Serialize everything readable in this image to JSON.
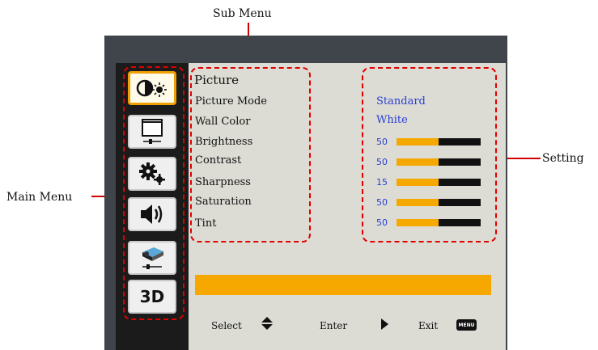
{
  "callouts": {
    "sub_menu": "Sub Menu",
    "setting": "Setting",
    "main_menu": "Main Menu"
  },
  "main_menu": {
    "items": [
      {
        "icon": "picture-icon",
        "active": true
      },
      {
        "icon": "screen-icon",
        "active": false
      },
      {
        "icon": "gears-icon",
        "active": false
      },
      {
        "icon": "speaker-icon",
        "active": false
      },
      {
        "icon": "projector-icon",
        "active": false
      },
      {
        "icon": "3d-icon",
        "label": "3D",
        "active": false
      }
    ]
  },
  "sub_menu": {
    "title": "Picture",
    "items": [
      "Picture Mode",
      "Wall Color",
      "Brightness",
      "Contrast",
      "Sharpness",
      "Saturation",
      "Tint"
    ]
  },
  "settings": {
    "picture_mode": "Standard",
    "wall_color": "White",
    "brightness": "50",
    "contrast": "50",
    "sharpness": "15",
    "saturation": "50",
    "tint": "50"
  },
  "bars": {
    "brightness": 0.5,
    "contrast": 0.5,
    "sharpness": 0.5,
    "saturation": 0.5,
    "tint": 0.5
  },
  "footer": {
    "select_label": "Select",
    "enter_label": "Enter",
    "exit_label": "Exit",
    "menu_key_label": "MENU"
  },
  "colors": {
    "accent_orange": "#f7a800",
    "value_blue": "#2a3fd0",
    "callout_red": "#d10000"
  }
}
